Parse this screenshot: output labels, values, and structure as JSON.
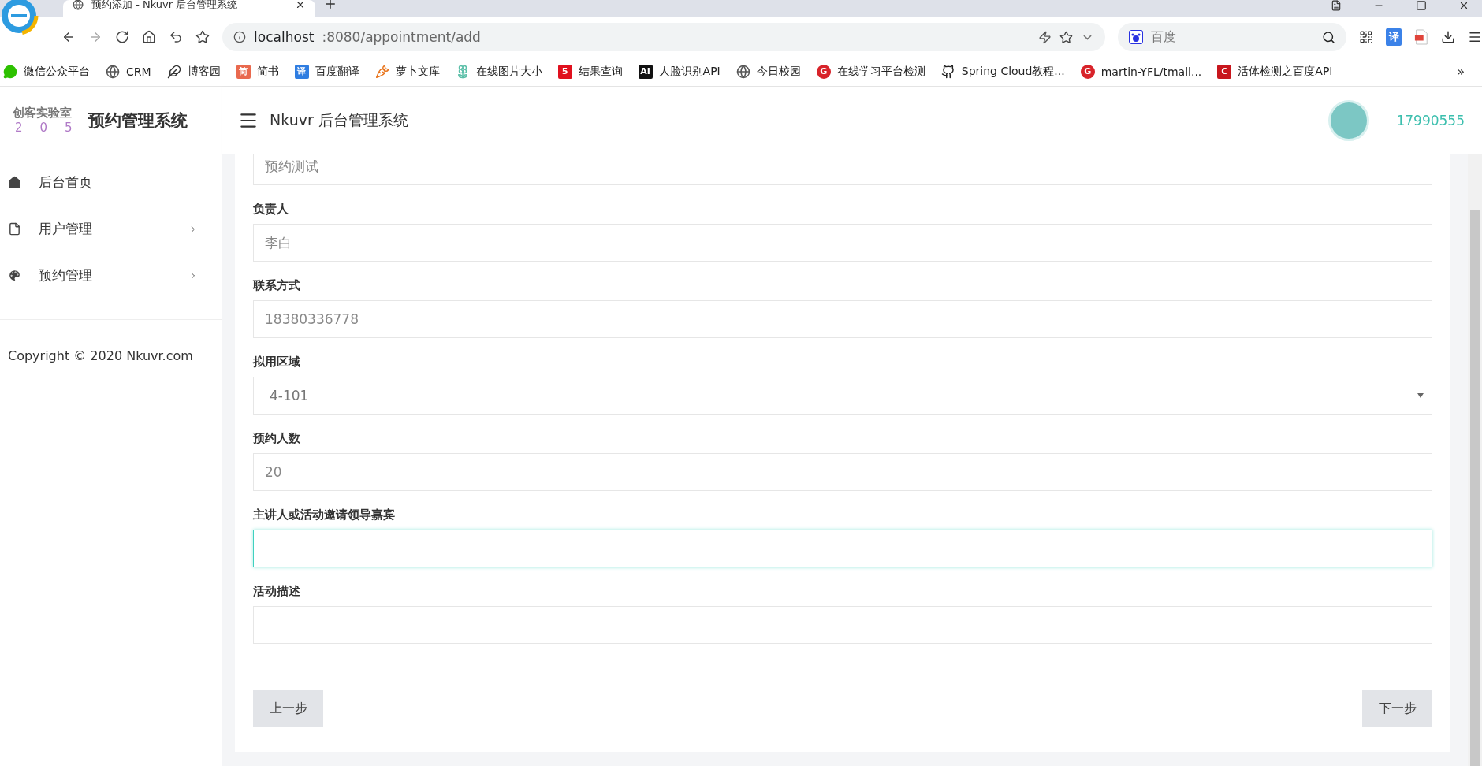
{
  "browser": {
    "tab_title": "预约添加 - Nkuvr 后台管理系统",
    "address_host": "localhost",
    "address_path": ":8080/appointment/add",
    "search_placeholder": "百度",
    "translate_label": "译",
    "bookmarks": [
      {
        "label": "微信公众平台",
        "kind": "wechat"
      },
      {
        "label": "CRM",
        "kind": "globe"
      },
      {
        "label": "博客园",
        "kind": "blog"
      },
      {
        "label": "简书",
        "kind": "badge",
        "icon_text": "简",
        "color": "#e9694e"
      },
      {
        "label": "百度翻译",
        "kind": "badge",
        "icon_text": "译",
        "color": "#2f7de1"
      },
      {
        "label": "萝卜文库",
        "kind": "carrot"
      },
      {
        "label": "在线图片大小",
        "kind": "flower"
      },
      {
        "label": "结果查询",
        "kind": "badge",
        "icon_text": "5",
        "color": "#e0101e"
      },
      {
        "label": "人脸识别API",
        "kind": "badge",
        "icon_text": "AI",
        "color": "#111111"
      },
      {
        "label": "今日校园",
        "kind": "globe"
      },
      {
        "label": "在线学习平台检测",
        "kind": "round",
        "icon_text": "G",
        "color": "#d8232a"
      },
      {
        "label": "Spring Cloud教程...",
        "kind": "github"
      },
      {
        "label": "martin-YFL/tmall...",
        "kind": "round",
        "icon_text": "G",
        "color": "#d8232a"
      },
      {
        "label": "活体检测之百度API",
        "kind": "badge",
        "icon_text": "C",
        "color": "#c8161d"
      }
    ],
    "more": "»"
  },
  "app": {
    "logo_title": "创客实验室",
    "logo_digits": [
      "2",
      "0",
      "5"
    ],
    "brand": "预约管理系统",
    "header_title": "Nkuvr 后台管理系统",
    "user": "17990555",
    "sidebar": [
      {
        "label": "后台首页",
        "kind": "home",
        "expandable": false
      },
      {
        "label": "用户管理",
        "kind": "file",
        "expandable": true
      },
      {
        "label": "预约管理",
        "kind": "palette",
        "expandable": true
      }
    ],
    "copyright": "Copyright © 2020 Nkuvr.com",
    "fields": [
      {
        "kind": "input",
        "value": "预约测试",
        "focused": false
      },
      {
        "kind": "input",
        "label": "负责人",
        "value": "李白",
        "focused": false
      },
      {
        "kind": "input",
        "label": "联系方式",
        "value": "18380336778",
        "focused": false
      },
      {
        "kind": "select",
        "label": "拟用区域",
        "value": "4-101",
        "focused": false
      },
      {
        "kind": "input",
        "label": "预约人数",
        "value": "20",
        "focused": false
      },
      {
        "kind": "input",
        "label": "主讲人或活动邀请领导嘉宾",
        "focused": true
      },
      {
        "kind": "input",
        "label": "活动描述",
        "focused": false
      }
    ],
    "prev_button": "上一步",
    "next_button": "下一步"
  }
}
